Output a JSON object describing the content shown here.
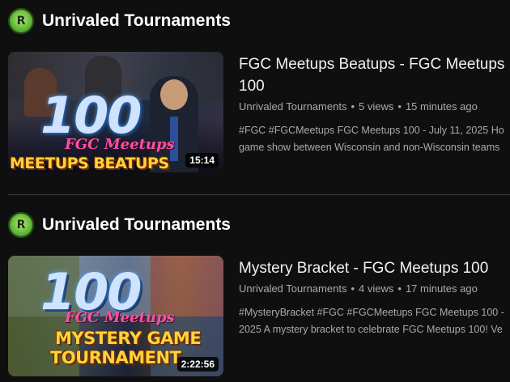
{
  "entries": [
    {
      "channel_name": "Unrivaled Tournaments",
      "channel_logo_initial": "R",
      "thumbnail": {
        "big_number": "100",
        "script_text": "FGC Meetups",
        "banner_lines": [
          "MEETUPS BEATUPS"
        ]
      },
      "duration": "15:14",
      "title_line1": "FGC Meetups Beatups - FGC Meetups",
      "title_line2": "100",
      "meta_channel": "Unrivaled Tournaments",
      "views": "5 views",
      "age": "15 minutes ago",
      "desc_line1": "#FGC #FGCMeetups FGC Meetups 100 - July 11, 2025 Ho",
      "desc_line2": "game show between Wisconsin and non-Wisconsin teams"
    },
    {
      "channel_name": "Unrivaled Tournaments",
      "channel_logo_initial": "R",
      "thumbnail": {
        "big_number": "100",
        "script_text": "FGC Meetups",
        "banner_lines": [
          "MYSTERY GAME",
          "TOURNAMENT"
        ]
      },
      "duration": "2:22:56",
      "title_line1": "Mystery Bracket - FGC Meetups 100",
      "title_line2": "",
      "meta_channel": "Unrivaled Tournaments",
      "views": "4 views",
      "age": "17 minutes ago",
      "desc_line1": "#MysteryBracket #FGC #FGCMeetups FGC Meetups 100 -",
      "desc_line2": "2025 A mystery bracket to celebrate FGC Meetups 100! Ve"
    }
  ],
  "separator": "•",
  "colors": {
    "background": "#0f0f0f",
    "title_text": "#f1f1f1",
    "meta_text": "#aaaaaa",
    "banner_yellow": "#ffd23a",
    "script_pink": "#ff4fa0",
    "logo_green": "#6bbf3b"
  }
}
